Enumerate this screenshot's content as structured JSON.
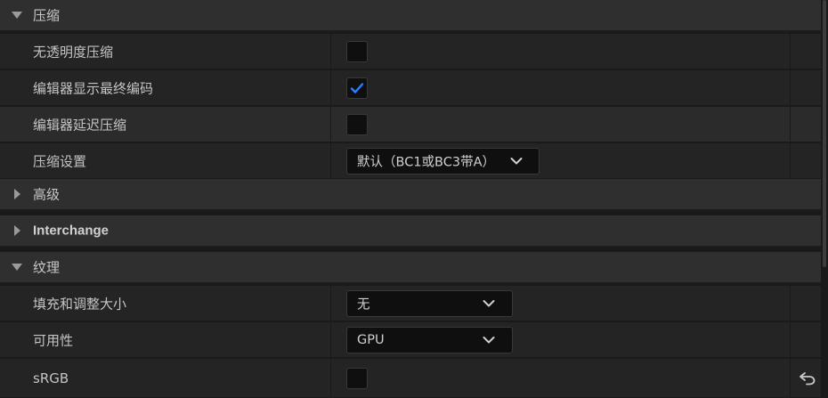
{
  "sections": {
    "compression": {
      "label": "压缩",
      "expanded": true
    },
    "advanced": {
      "label": "高级",
      "expanded": false
    },
    "interchange": {
      "label": "Interchange",
      "expanded": false
    },
    "texture": {
      "label": "纹理",
      "expanded": true
    }
  },
  "properties": {
    "no_alpha_compression": {
      "label": "无透明度压缩",
      "checked": false
    },
    "editor_show_final_encode": {
      "label": "编辑器显示最终编码",
      "checked": true
    },
    "editor_defer_compression": {
      "label": "编辑器延迟压缩",
      "checked": false
    },
    "compression_settings": {
      "label": "压缩设置",
      "value": "默认（BC1或BC3带A）"
    },
    "pad_and_resize": {
      "label": "填充和调整大小",
      "value": "无"
    },
    "availability": {
      "label": "可用性",
      "value": "GPU"
    },
    "srgb": {
      "label": "sRGB",
      "checked": false
    }
  },
  "icons": {
    "expanded_arrow": "triangle-down-icon",
    "collapsed_arrow": "triangle-right-icon",
    "checkmark": "checkmark-icon",
    "dropdown": "chevron-down-icon",
    "reset": "reset-to-default-icon"
  },
  "colors": {
    "checkmark": "#2a7fff",
    "section_bg": "#2f2f2f",
    "row_bg": "#242424",
    "input_bg": "#0f0f0f"
  }
}
